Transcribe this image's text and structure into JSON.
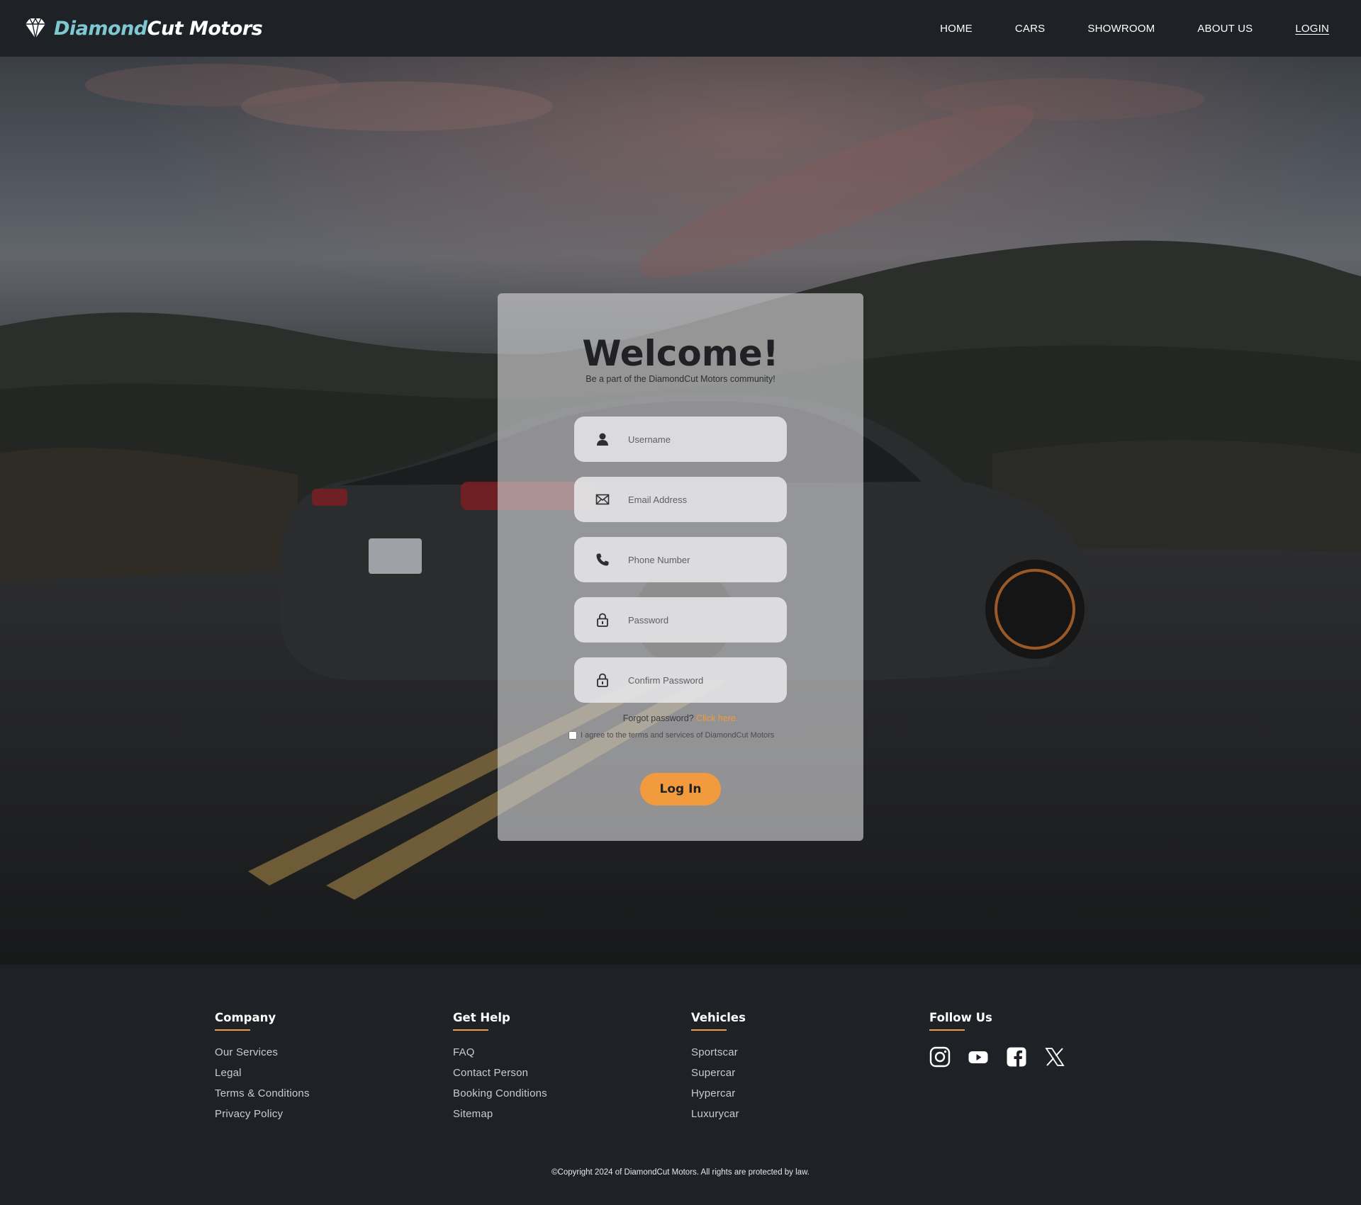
{
  "nav": {
    "brand_part1": "Diamond",
    "brand_part2": "Cut",
    "brand_part3": "Motors",
    "links": [
      {
        "label": "HOME"
      },
      {
        "label": "CARS"
      },
      {
        "label": "SHOWROOM"
      },
      {
        "label": "ABOUT US"
      },
      {
        "label": "LOGIN"
      }
    ]
  },
  "form": {
    "title": "Welcome!",
    "subtitle": "Be a part of the DiamondCut Motors community!",
    "fields": {
      "username": {
        "placeholder": "Username",
        "icon": "user-icon"
      },
      "email": {
        "placeholder": "Email Address",
        "icon": "envelope-icon"
      },
      "phone": {
        "placeholder": "Phone Number",
        "icon": "phone-icon"
      },
      "password": {
        "placeholder": "Password",
        "icon": "lock-icon"
      },
      "confirm_password": {
        "placeholder": "Confirm Password",
        "icon": "lock-icon"
      }
    },
    "forgot_text": "Forgot password?",
    "forgot_link": "Click here.",
    "agree_text": "I agree to the terms and services of DiamondCut Motors",
    "submit_label": "Log In"
  },
  "footer": {
    "company": {
      "heading": "Company",
      "items": [
        "Our Services",
        "Legal",
        "Terms & Conditions",
        "Privacy Policy"
      ]
    },
    "help": {
      "heading": "Get Help",
      "items": [
        "FAQ",
        "Contact Person",
        "Booking Conditions",
        "Sitemap"
      ]
    },
    "vehicles": {
      "heading": "Vehicles",
      "items": [
        "Sportscar",
        "Supercar",
        "Hypercar",
        "Luxurycar"
      ]
    },
    "follow": {
      "heading": "Follow Us",
      "icons": [
        "instagram-icon",
        "youtube-icon",
        "facebook-icon",
        "x-icon"
      ]
    },
    "copyright": "©Copyright 2024 of DiamondCut Motors. All rights are protected by law."
  },
  "colors": {
    "accent": "#f29a3e",
    "brand": "#7ec9d1",
    "navbar": "#1e2226"
  }
}
